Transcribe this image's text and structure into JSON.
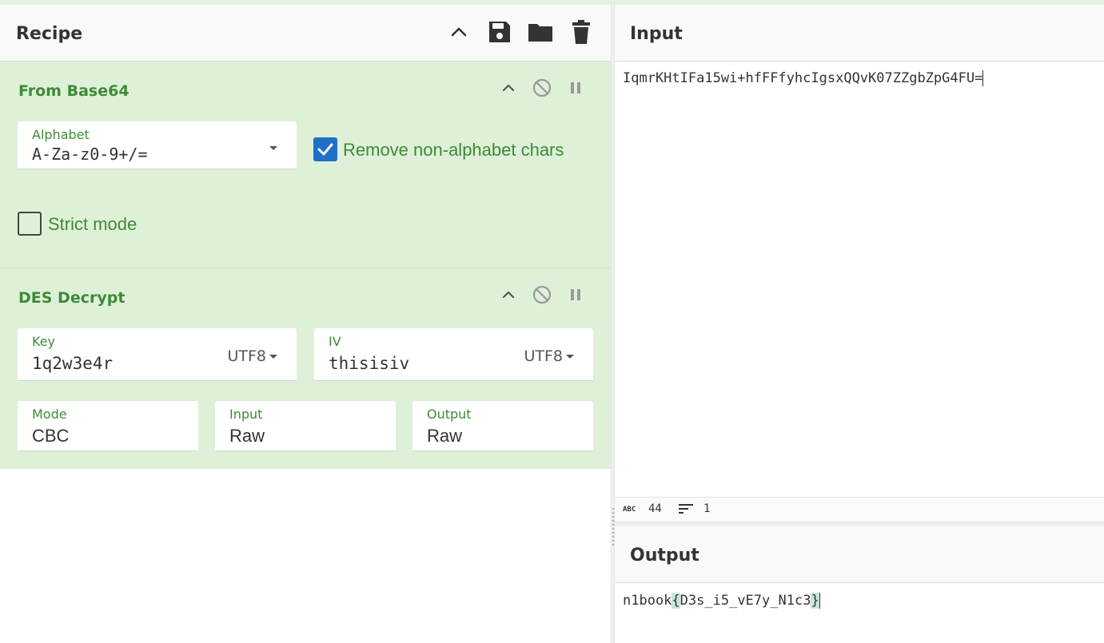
{
  "recipe": {
    "title": "Recipe",
    "icons": [
      "chevron-up-icon",
      "save-icon",
      "folder-icon",
      "trash-icon"
    ],
    "operations": [
      {
        "name": "From Base64",
        "alphabet_label": "Alphabet",
        "alphabet_value": "A-Za-z0-9+/=",
        "remove_nonalpha_label": "Remove non-alphabet chars",
        "remove_nonalpha_checked": true,
        "strict_label": "Strict mode",
        "strict_checked": false
      },
      {
        "name": "DES Decrypt",
        "key_label": "Key",
        "key_value": "1q2w3e4r",
        "key_encoding": "UTF8",
        "iv_label": "IV",
        "iv_value": "thisisiv",
        "iv_encoding": "UTF8",
        "mode_label": "Mode",
        "mode_value": "CBC",
        "input_label": "Input",
        "input_value": "Raw",
        "output_label": "Output",
        "output_value": "Raw"
      }
    ]
  },
  "input": {
    "title": "Input",
    "text": "IqmrKHtIFa15wi+hfFFfyhcIgsxQQvK07ZZgbZpG4FU=",
    "status_chars_icon": "ABC",
    "status_chars": "44",
    "status_lines": "1"
  },
  "output": {
    "title": "Output",
    "text_prefix": "n1book",
    "brace_open": "{",
    "text_inner": "D3s_i5_vE7y_N1c3",
    "brace_close": "}"
  },
  "colors": {
    "op_bg": "#dff0d8",
    "op_text": "#3d8b37",
    "checkbox_on": "#1e70c9"
  }
}
